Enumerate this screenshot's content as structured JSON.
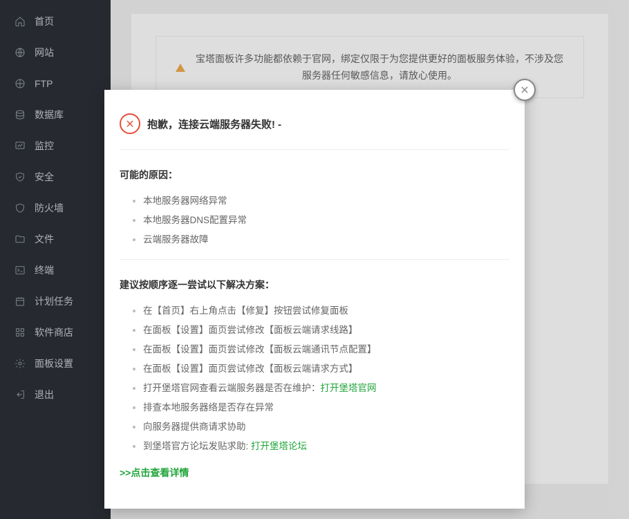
{
  "sidebar": {
    "items": [
      {
        "label": "首页"
      },
      {
        "label": "网站"
      },
      {
        "label": "FTP"
      },
      {
        "label": "数据库"
      },
      {
        "label": "监控"
      },
      {
        "label": "安全"
      },
      {
        "label": "防火墙"
      },
      {
        "label": "文件"
      },
      {
        "label": "终端"
      },
      {
        "label": "计划任务"
      },
      {
        "label": "软件商店"
      },
      {
        "label": "面板设置"
      },
      {
        "label": "退出"
      }
    ]
  },
  "notice": {
    "text": "宝塔面板许多功能都依赖于官网，绑定仅限于为您提供更好的面板服务体验，不涉及您服务器任何敏感信息，请放心使用。"
  },
  "dialog": {
    "title": "抱歉，连接云端服务器失败! -",
    "reasons": {
      "heading": "可能的原因：",
      "items": [
        "本地服务器网络异常",
        "本地服务器DNS配置异常",
        "云端服务器故障"
      ]
    },
    "solutions": {
      "heading": "建议按顺序逐一尝试以下解决方案：",
      "items": [
        {
          "text": "在【首页】右上角点击【修复】按钮尝试修复面板"
        },
        {
          "text": "在面板【设置】面页尝试修改【面板云端请求线路】"
        },
        {
          "text": "在面板【设置】面页尝试修改【面板云端通讯节点配置】"
        },
        {
          "text": "在面板【设置】面页尝试修改【面板云端请求方式】"
        },
        {
          "text": "打开堡塔官网查看云端服务器是否在维护：",
          "link": "打开堡塔官网"
        },
        {
          "text": "排查本地服务器络是否存在异常"
        },
        {
          "text": "向服务器提供商请求协助"
        },
        {
          "text": "到堡塔官方论坛发贴求助: ",
          "link": "打开堡塔论坛"
        }
      ]
    },
    "details_link": ">>点击查看详情"
  }
}
